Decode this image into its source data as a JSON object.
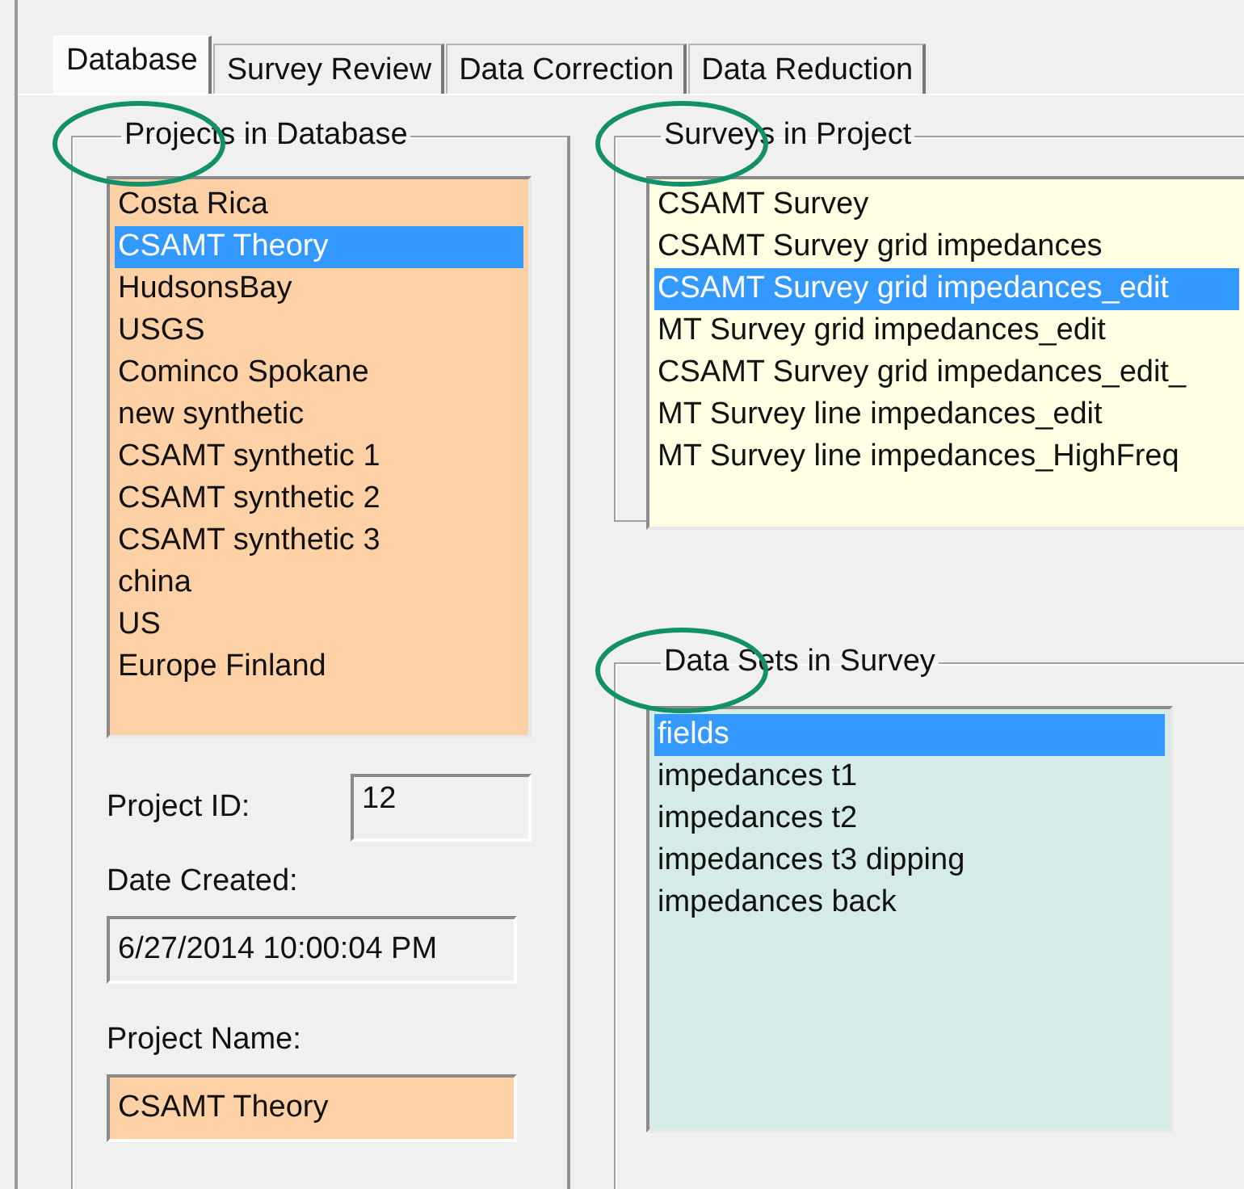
{
  "tabs": [
    {
      "label": "Database",
      "selected": true
    },
    {
      "label": "Survey Review",
      "selected": false
    },
    {
      "label": "Data Correction",
      "selected": false
    },
    {
      "label": "Data Reduction",
      "selected": false
    }
  ],
  "projects": {
    "title": "Projects in Database",
    "circled": true,
    "items": [
      {
        "label": "Costa Rica",
        "selected": false
      },
      {
        "label": "CSAMT Theory",
        "selected": true
      },
      {
        "label": "HudsonsBay",
        "selected": false
      },
      {
        "label": "USGS",
        "selected": false
      },
      {
        "label": "Cominco Spokane",
        "selected": false
      },
      {
        "label": "new synthetic",
        "selected": false
      },
      {
        "label": "CSAMT synthetic 1",
        "selected": false
      },
      {
        "label": "CSAMT synthetic 2",
        "selected": false
      },
      {
        "label": "CSAMT synthetic 3",
        "selected": false
      },
      {
        "label": "china",
        "selected": false
      },
      {
        "label": "US",
        "selected": false
      },
      {
        "label": "Europe Finland",
        "selected": false
      }
    ]
  },
  "project_id": {
    "label": "Project ID:",
    "value": "12"
  },
  "date_created": {
    "label": "Date Created:",
    "value": "6/27/2014 10:00:04 PM"
  },
  "project_name": {
    "label": "Project Name:",
    "value": "CSAMT Theory"
  },
  "surveys": {
    "title": "Surveys in Project",
    "circled": true,
    "items": [
      {
        "label": "CSAMT Survey",
        "selected": false
      },
      {
        "label": "CSAMT Survey grid impedances",
        "selected": false
      },
      {
        "label": "CSAMT Survey grid impedances_edit",
        "selected": true
      },
      {
        "label": "MT Survey grid impedances_edit",
        "selected": false
      },
      {
        "label": "CSAMT Survey grid impedances_edit_",
        "selected": false
      },
      {
        "label": "MT Survey line impedances_edit",
        "selected": false
      },
      {
        "label": "MT Survey line impedances_HighFreq",
        "selected": false
      }
    ]
  },
  "data_sets": {
    "title": "Data Sets in Survey",
    "circled": true,
    "items": [
      {
        "label": "fields",
        "selected": true
      },
      {
        "label": "impedances t1",
        "selected": false
      },
      {
        "label": "impedances t2",
        "selected": false
      },
      {
        "label": "impedances t3 dipping",
        "selected": false
      },
      {
        "label": "impedances back",
        "selected": false
      }
    ]
  }
}
